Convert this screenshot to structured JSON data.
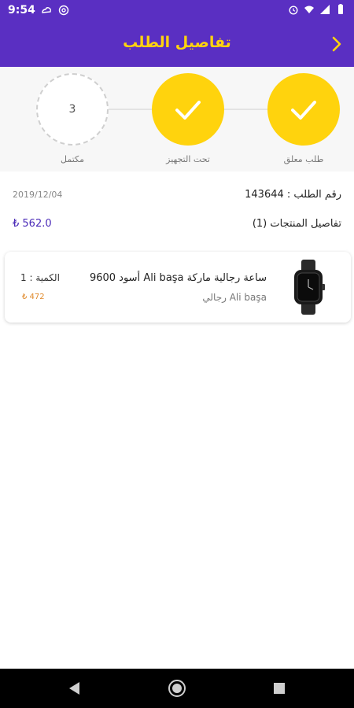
{
  "status_bar": {
    "time": "9:54",
    "left_icons": [
      "signal-cloud-icon",
      "at-sign-icon"
    ],
    "right_icons": [
      "alarm-icon",
      "wifi-icon",
      "cellular-icon",
      "battery-icon"
    ]
  },
  "header": {
    "title": "تفاصيل الطلب",
    "back_icon": "chevron-right-icon",
    "background": "#5a2fc2",
    "title_color": "#ffd30d"
  },
  "steps": [
    {
      "label": "طلب معلق",
      "state": "done"
    },
    {
      "label": "تحت التجهيز",
      "state": "done"
    },
    {
      "label": "مكتمل",
      "state": "pending",
      "number": "3"
    }
  ],
  "order": {
    "number_text": "رقم الطلب : 143644",
    "date": "2019/12/04",
    "products_title": "تفاصيل المنتجات (1)",
    "total": "₺ 562.0"
  },
  "product": {
    "name": "ساعة رجالية ماركة Ali başa أسود 9600",
    "brand": "Ali başa رجالي",
    "quantity": "الكمية : 1",
    "price": "₺ 472",
    "image_icon": "wristwatch-icon"
  },
  "nav_bar": {
    "icons": [
      "back-triangle-icon",
      "home-circle-icon",
      "recents-square-icon"
    ]
  }
}
